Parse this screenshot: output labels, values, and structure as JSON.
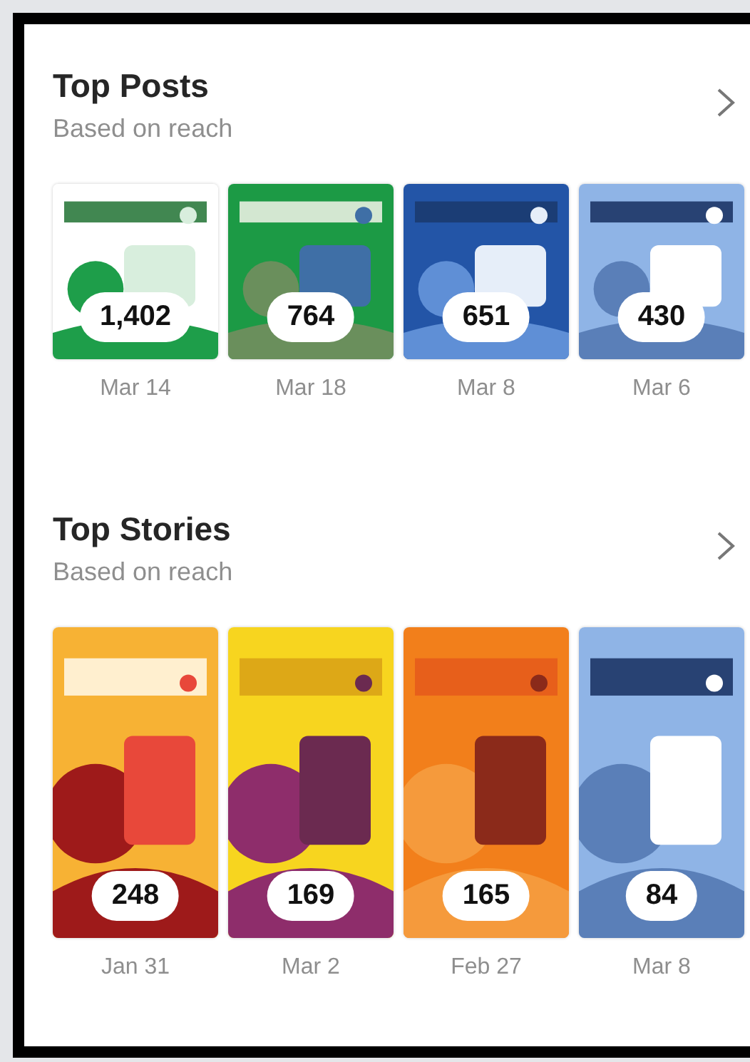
{
  "sections": [
    {
      "title": "Top Posts",
      "subtitle": "Based on reach",
      "kind": "post",
      "items": [
        {
          "count": "1,402",
          "date": "Mar 14"
        },
        {
          "count": "764",
          "date": "Mar 18"
        },
        {
          "count": "651",
          "date": "Mar 8"
        },
        {
          "count": "430",
          "date": "Mar 6"
        }
      ]
    },
    {
      "title": "Top Stories",
      "subtitle": "Based on reach",
      "kind": "story",
      "items": [
        {
          "count": "248",
          "date": "Jan 31"
        },
        {
          "count": "169",
          "date": "Mar 2"
        },
        {
          "count": "165",
          "date": "Feb 27"
        },
        {
          "count": "84",
          "date": "Mar 8"
        }
      ]
    }
  ]
}
